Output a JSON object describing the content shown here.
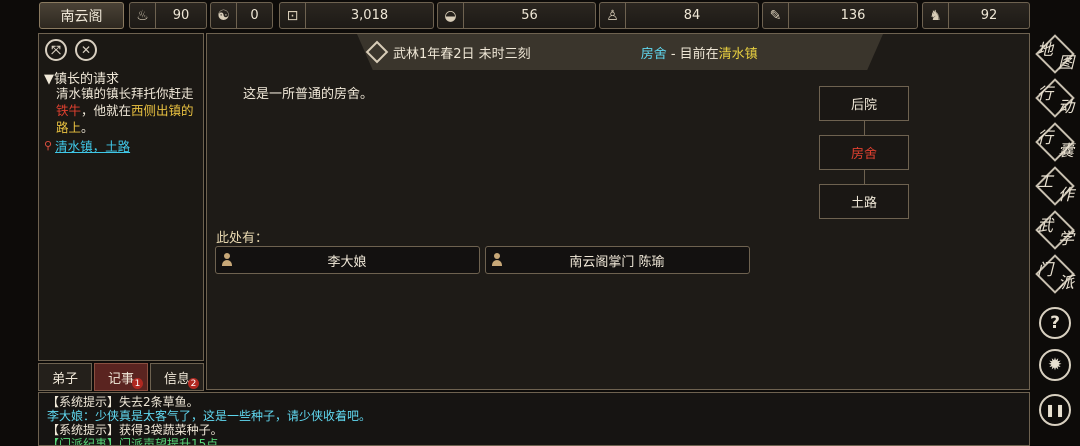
{
  "topbar": {
    "sect_name": "南云阁",
    "stats": [
      {
        "icon": "gourd-icon",
        "value": "90"
      },
      {
        "icon": "yin-yang-icon",
        "value": "0"
      },
      {
        "icon": "coin-icon",
        "value": "3,018"
      },
      {
        "icon": "rice-bowl-icon",
        "value": "56"
      },
      {
        "icon": "person-meditate-icon",
        "value": "84"
      },
      {
        "icon": "scroll-icon",
        "value": "136"
      },
      {
        "icon": "lion-icon",
        "value": "92"
      }
    ]
  },
  "quest": {
    "title": "▼镇长的请求",
    "body_1": "清水镇的镇长拜托你赶走",
    "body_red": "铁牛",
    "body_2": "，他就在",
    "body_gold": "西侧出镇的路上",
    "body_3": "。",
    "location": "清水镇，土路"
  },
  "left_tabs": [
    {
      "label": "弟子",
      "badge": ""
    },
    {
      "label": "记事",
      "badge": "1"
    },
    {
      "label": "信息",
      "badge": "2"
    }
  ],
  "header": {
    "date": "武林1年春2日 未时三刻",
    "place": "房舍",
    "sep": " - 目前在",
    "town": "清水镇"
  },
  "description": "这是一所普通的房舍。",
  "rooms": {
    "north": "后院",
    "current": "房舍",
    "south": "土路"
  },
  "here_label": "此处有：",
  "npcs": [
    "李大娘",
    "南云阁掌门 陈瑜"
  ],
  "right_menu": [
    {
      "c1": "地",
      "c2": "图"
    },
    {
      "c1": "行",
      "c2": "动"
    },
    {
      "c1": "行",
      "c2": "囊"
    },
    {
      "c1": "工",
      "c2": "作"
    },
    {
      "c1": "武",
      "c2": "学"
    },
    {
      "c1": "门",
      "c2": "派"
    }
  ],
  "round_buttons": [
    "?",
    "✹",
    "❚❚"
  ],
  "log": [
    {
      "style": "white",
      "text": "【系统提示】失去2条草鱼。"
    },
    {
      "style": "cyan",
      "text": "李大娘：少侠真是太客气了，这是一些种子，请少侠收着吧。"
    },
    {
      "style": "white",
      "text": "【系统提示】获得3袋蔬菜种子。"
    },
    {
      "style": "green",
      "text": "【门派纪事】门派声望提升15点。"
    }
  ]
}
